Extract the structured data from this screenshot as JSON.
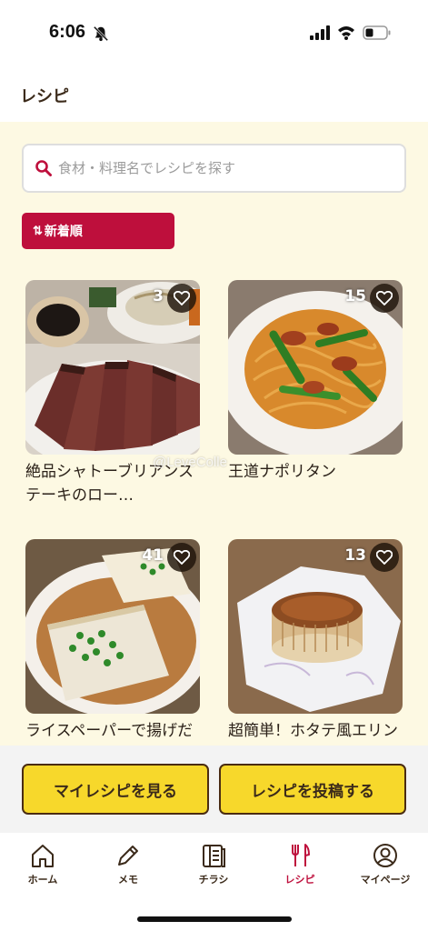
{
  "status_bar": {
    "time": "6:06"
  },
  "header": {
    "title": "レシピ"
  },
  "search": {
    "placeholder": "食材・料理名でレシピを探す",
    "value": ""
  },
  "sort": {
    "label": "新着順",
    "icon": "sort-arrows-icon"
  },
  "recipes": [
    {
      "likes": "3",
      "title": "絶品シャトーブリアンステーキのロー…"
    },
    {
      "likes": "15",
      "title": "王道ナポリタン"
    },
    {
      "likes": "41",
      "title": "ライスペーパーで揚げだし豆腐"
    },
    {
      "likes": "13",
      "title": "超簡単！ホタテ風エリンギ"
    }
  ],
  "watermark": "@LeveColle",
  "actions": {
    "my_recipes": "マイレシピを見る",
    "post_recipe": "レシピを投稿する"
  },
  "tabs": [
    {
      "label": "ホーム",
      "icon": "home-icon"
    },
    {
      "label": "メモ",
      "icon": "pencil-icon"
    },
    {
      "label": "チラシ",
      "icon": "flyer-icon"
    },
    {
      "label": "レシピ",
      "icon": "fork-knife-icon"
    },
    {
      "label": "マイページ",
      "icon": "user-icon"
    }
  ],
  "colors": {
    "accent": "#be0f3c",
    "background": "#fdf9e3",
    "button": "#f7d82b",
    "text": "#3b2a1a"
  }
}
